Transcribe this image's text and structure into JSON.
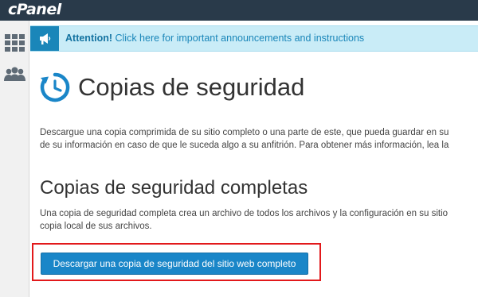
{
  "topbar": {
    "logo_text": "cPanel"
  },
  "sidebar": {
    "items": [
      {
        "icon": "grid-icon"
      },
      {
        "icon": "users-icon"
      }
    ]
  },
  "notice": {
    "icon": "megaphone-icon",
    "strong": "Attention!",
    "link_text": " Click here for important announcements and instructions"
  },
  "page": {
    "title": "Copias de seguridad",
    "description_lines": [
      "Descargue una copia comprimida de su sitio completo o una parte de este, que pueda guardar en su",
      "de su información en caso de que le suceda algo a su anfitrión. Para obtener más información, lea la"
    ]
  },
  "full_backup": {
    "title": "Copias de seguridad completas",
    "description_lines": [
      "Una copia de seguridad completa crea un archivo de todos los archivos y la configuración en su sitio",
      "copia local de sus archivos."
    ],
    "button_label": "Descargar una copia de seguridad del sitio web completo"
  },
  "colors": {
    "topbar": "#293a4a",
    "notice_bg": "#c9ecf7",
    "notice_text": "#1a86b9",
    "button": "#1a86c8",
    "highlight": "#e2191b"
  }
}
